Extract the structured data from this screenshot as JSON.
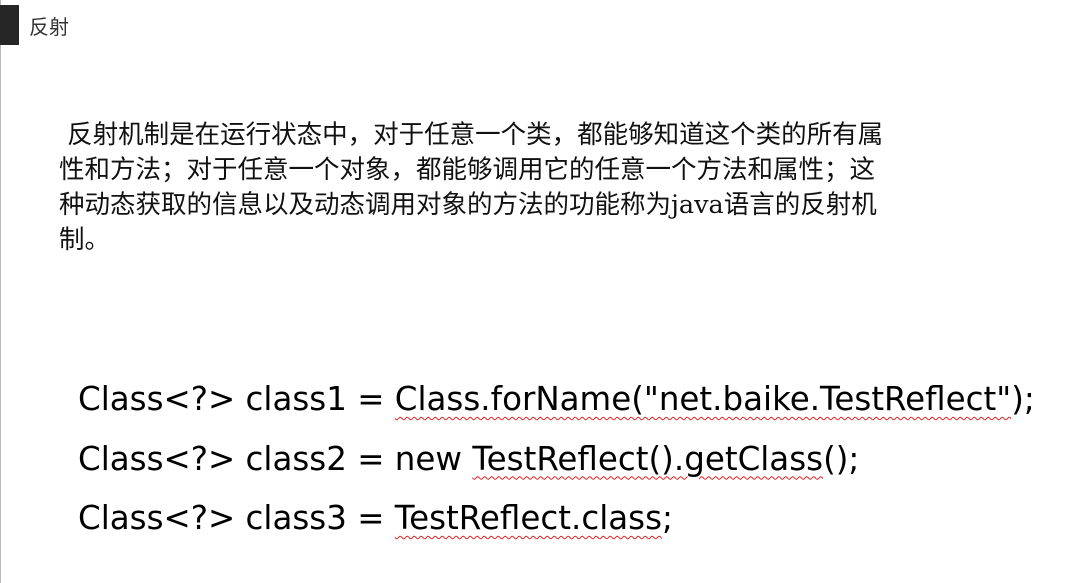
{
  "slide": {
    "title": "反射",
    "description": " 反射机制是在运行状态中，对于任意一个类，都能够知道这个类的所有属\n性和方法；对于任意一个对象，都能够调用它的任意一个方法和属性；这\n种动态获取的信息以及动态调用对象的方法的功能称为java语言的反射机\n制。",
    "code": [
      {
        "prefix": "Class<?> class1 = ",
        "underlined": "Class.forName(\"net.baike.TestReflect\"",
        "suffix": ");"
      },
      {
        "prefix": "Class<?> class2 = new ",
        "underlined": "TestReflect().getClass",
        "suffix": "();"
      },
      {
        "prefix": "Class<?> class3 = ",
        "underlined": "TestReflect.class",
        "suffix": ";"
      }
    ],
    "colors": {
      "title_marker": "#262626",
      "spellcheck_underline": "#e02020",
      "left_rule": "#b8b8b8"
    }
  }
}
